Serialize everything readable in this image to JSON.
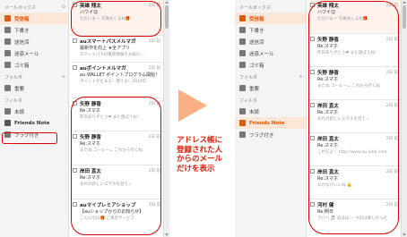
{
  "left": {
    "sidebar": {
      "mailbox_header": "メールボックス",
      "mailbox_action": "⊙",
      "items": [
        {
          "label": "受信箱",
          "icon": "inbox-icon",
          "color": "#e05a0c",
          "active": true
        },
        {
          "label": "下書き",
          "icon": "draft-icon",
          "color": "#666"
        },
        {
          "label": "送信済",
          "icon": "sent-icon",
          "color": "#666"
        },
        {
          "label": "迷惑メール",
          "icon": "spam-icon",
          "color": "#666"
        },
        {
          "label": "ゴミ箱",
          "icon": "trash-icon",
          "color": "#666"
        }
      ],
      "folder_header": "フォルダ",
      "folder_add": "+",
      "folders": [
        {
          "label": "重要",
          "icon": "folder-icon"
        }
      ],
      "filter_header": "フィルタ",
      "filters": [
        {
          "label": "未読",
          "icon": "unread-icon"
        },
        {
          "label": "Friends Note",
          "icon": "friends-icon"
        },
        {
          "label": "フラグ付き",
          "icon": "flag-icon"
        }
      ]
    },
    "mails": [
      {
        "sender": "英雄 翔太",
        "date": "2日 前",
        "subject": "ハワイ😊",
        "preview": "ただいま〜 写真おくるね🎁"
      },
      {
        "sender": "auスマートパスメルマガ",
        "date": "2日 前",
        "subject": "最新作を向上 ★全アプリ",
        "preview": "スマートパスの最新情報をお届け…"
      },
      {
        "sender": "auポイントメルマガ",
        "date": "2日 前",
        "subject": "au WALLET ポイントプログラム開始！",
        "preview": "ポイントがたまる！使える！2014年"
      },
      {
        "sender": "矢野 静香",
        "date": "2日 前",
        "subject": "Re:スマホ",
        "preview": "昨日ありがとう❤ また遊ぼうね！"
      },
      {
        "sender": "矢野 静香",
        "date": "2日 前",
        "subject": "Re:スマホ",
        "preview": "またね コーヒー☕ これから行くね"
      },
      {
        "sender": "岸田 直太",
        "date": "2日 前",
        "subject": "Re:スマホ",
        "preview": "あれの新しいスマホを見て☆"
      },
      {
        "sender": "auマイプレミアショップ",
        "date": "2日 前",
        "subject": "【auショップからのお知らせ】",
        "preview": "こんにちは🎁 ご来店サービス"
      }
    ]
  },
  "right": {
    "sidebar": {
      "mailbox_header": "メールボックス",
      "items": [
        {
          "label": "受信箱",
          "icon": "inbox-icon",
          "color": "#e05a0c",
          "active": true
        },
        {
          "label": "下書き",
          "icon": "draft-icon",
          "color": "#666"
        },
        {
          "label": "送信済",
          "icon": "sent-icon",
          "color": "#666"
        },
        {
          "label": "迷惑メール",
          "icon": "spam-icon",
          "color": "#666"
        },
        {
          "label": "ゴミ箱",
          "icon": "trash-icon",
          "color": "#666"
        }
      ],
      "folder_header": "フォルダ",
      "folder_add": "+",
      "folders": [
        {
          "label": "重要",
          "icon": "folder-icon"
        }
      ],
      "filter_header": "フィルタ",
      "filters": [
        {
          "label": "未読",
          "icon": "unread-icon"
        },
        {
          "label": "Friends Note",
          "icon": "friends-icon"
        },
        {
          "label": "フラグ付き",
          "icon": "flag-icon"
        }
      ]
    },
    "mails": [
      {
        "sender": "英雄 翔太",
        "date": "2日 前",
        "subject": "ハワイ😊",
        "preview": "ただいま〜 写真おくるね🎁"
      },
      {
        "sender": "矢野 静香",
        "date": "2日 前",
        "subject": "Re:スマホ",
        "preview": "昨日ありがとう❤ また遊ぼうね！"
      },
      {
        "sender": "矢野 静香",
        "date": "2日 前",
        "subject": "Re:スマホ",
        "preview": "またね コーヒー☕ これから行くね"
      },
      {
        "sender": "岸田 直太",
        "date": "2日 前",
        "subject": "Re:スマホ",
        "preview": "あれの新しいスマホを見て☆"
      },
      {
        "sender": "岸田 直太",
        "date": "2日 前",
        "subject": "Re:スマホ",
        "preview": "これだよ！ http://www.au.kddi.com"
      },
      {
        "sender": "岸田 直太",
        "date": "2日 前",
        "subject": "Re:スマホ",
        "preview": "なかなかいいね 👍"
      },
      {
        "sender": "河村 健",
        "date": "2日 前",
        "subject": "Re:明日",
        "preview": "アハハ 🎵 あはは ☆ 今日は楽しかった"
      }
    ]
  },
  "caption": [
    "アドレス帳に",
    "登録された人",
    "からのメール",
    "だけを表示"
  ],
  "colors": {
    "accent": "#e05a0c",
    "highlight": "#d00",
    "arrow": "#fbb084",
    "caption": "#e0200c"
  }
}
